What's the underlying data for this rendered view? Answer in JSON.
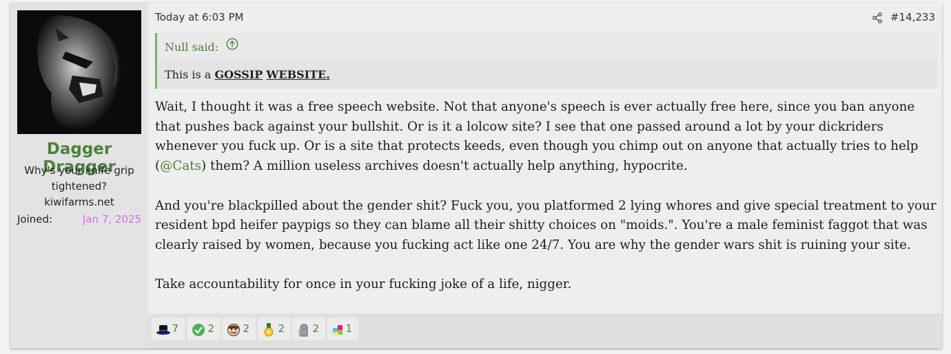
{
  "user": {
    "name": "Dagger Dragger",
    "title_line1": "Why's your knife grip",
    "title_line2": "tightened?",
    "title_line3": "kiwifarms.net",
    "joined_label": "Joined:",
    "joined_date": "Jan 7, 2025"
  },
  "post": {
    "date": "Today at 6:03 PM",
    "number": "#14,233",
    "share_icon": "share-icon"
  },
  "quote": {
    "author": "Null said:",
    "text_prefix": "This is a ",
    "bold1": "GOSSIP",
    "bold2": "WEBSITE",
    "suffix": "."
  },
  "message": {
    "p1_before": "Wait, I thought it was a free speech website. Not that anyone's speech is ever actually free here, since you ban anyone that pushes back against your bullshit. Or is it a lolcow site? I see that one passed around a lot by your dickriders whenever you fuck up. Or is a site that protects keeds, even though you chimp out on anyone that actually tries to help (",
    "mention": "@Cats",
    "p1_after": ") them? A million useless archives doesn't actually help anything, hypocrite.",
    "p2": "And you're blackpilled about the gender shit? Fuck you, you platformed 2 lying whores and give special treatment to your resident bpd heifer paypigs so they can blame all their shitty choices on \"moids.\". You're a male feminist faggot that was clearly raised by women, because you fucking act like one 24/7. You are why the gender wars shit is ruining your site.",
    "p3": "Take accountability for once in your fucking joke of a life, nigger."
  },
  "reactions": [
    {
      "icon": "top-hat-icon",
      "count": "7"
    },
    {
      "icon": "checkmark-icon",
      "count": "2"
    },
    {
      "icon": "face-icon",
      "count": "2"
    },
    {
      "icon": "medal-icon",
      "count": "2"
    },
    {
      "icon": "tombstone-icon",
      "count": "2"
    },
    {
      "icon": "puzzle-icon",
      "count": "1"
    }
  ],
  "colors": {
    "accent": "#4f7f3e",
    "joined_date": "#d86cf0",
    "quote_border": "#7fae6a"
  }
}
